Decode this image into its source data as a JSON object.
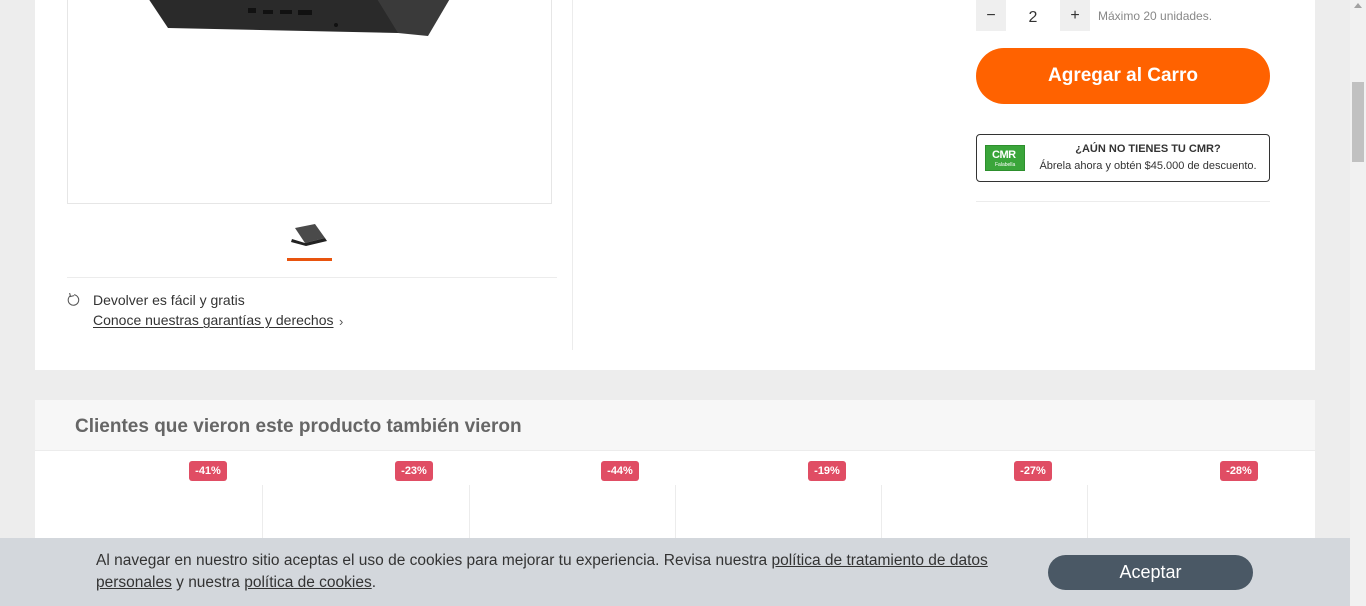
{
  "product": {
    "quantity": {
      "minus_label": "−",
      "value": "2",
      "plus_label": "+",
      "max_note": "Máximo 20 unidades."
    },
    "add_to_cart_label": "Agregar al Carro",
    "cmr_banner": {
      "logo_text": "CMR",
      "logo_subtext": "Falabella",
      "title": "¿AÚN NO TIENES TU CMR?",
      "subtitle": "Ábrela ahora y obtén $45.000 de descuento."
    },
    "returns": {
      "title": "Devolver es fácil y gratis",
      "link": "Conoce nuestras garantías y derechos",
      "icon": "return-arrow-icon"
    },
    "thumbnail_icon": "laptop-thumbnail"
  },
  "recommendations": {
    "title": "Clientes que vieron este producto también vieron",
    "discounts": [
      "-41%",
      "-23%",
      "-44%",
      "-19%",
      "-27%",
      "-28%"
    ]
  },
  "cookie_banner": {
    "text_1": "Al navegar en nuestro sitio aceptas el uso de cookies para mejorar tu experiencia. Revisa nuestra ",
    "link_1": "política de tratamiento de datos personales",
    "text_2": " y nuestra ",
    "link_2": "política de cookies",
    "text_3": ".",
    "accept_label": "Aceptar"
  },
  "colors": {
    "accent": "#ff6200",
    "badge": "#e04d64",
    "cookie_button": "#4a5865",
    "cmr_green": "#3aa53a"
  }
}
